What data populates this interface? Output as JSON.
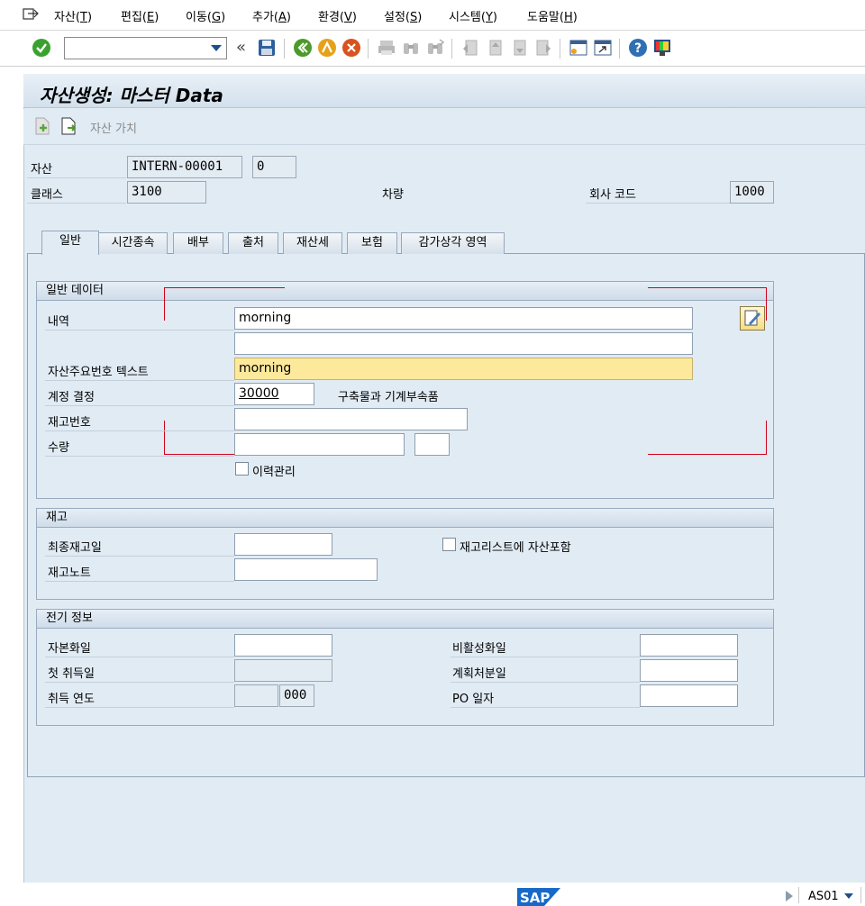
{
  "menu": {
    "items": [
      {
        "label": "자산(",
        "key": "T",
        "end": ")"
      },
      {
        "label": "편집(",
        "key": "E",
        "end": ")"
      },
      {
        "label": "이동(",
        "key": "G",
        "end": ")"
      },
      {
        "label": "추가(",
        "key": "A",
        "end": ")"
      },
      {
        "label": "환경(",
        "key": "V",
        "end": ")"
      },
      {
        "label": "설정(",
        "key": "S",
        "end": ")"
      },
      {
        "label": "시스템(",
        "key": "Y",
        "end": ")"
      },
      {
        "label": "도움말(",
        "key": "H",
        "end": ")"
      }
    ]
  },
  "toolbar": {
    "command_value": "",
    "icons": [
      "check-icon",
      "save-icon",
      "back-icon",
      "exit-icon",
      "cancel-icon",
      "print-icon",
      "find-icon",
      "find-next-icon",
      "first-page-icon",
      "prev-page-icon",
      "next-page-icon",
      "last-page-icon",
      "new-session-icon",
      "shortcut-icon",
      "help-icon",
      "customize-layout-icon"
    ],
    "collapse_glyph": "«"
  },
  "header": {
    "title": "자산생성:  마스터 Data"
  },
  "app_toolbar": {
    "asset_value_label": "자산 가치"
  },
  "asset_header": {
    "asset_label": "자산",
    "asset_number": "INTERN-00001",
    "sub_number": "0",
    "class_label": "클래스",
    "class_value": "3100",
    "vehicle_label": "차량",
    "company_code_label": "회사 코드",
    "company_code_value": "1000"
  },
  "tabs": [
    {
      "label": "일반",
      "active": true
    },
    {
      "label": "시간종속",
      "active": false
    },
    {
      "label": "배부",
      "active": false
    },
    {
      "label": "출처",
      "active": false
    },
    {
      "label": "재산세",
      "active": false
    },
    {
      "label": "보험",
      "active": false
    },
    {
      "label": "감가상각 영역",
      "active": false
    }
  ],
  "general_data": {
    "title": "일반 데이터",
    "description_label": "내역",
    "description_value": "morning",
    "description2_value": "",
    "main_number_text_label": "자산주요번호 텍스트",
    "main_number_text_value": "morning",
    "account_determination_label": "계정 결정",
    "account_determination_value": "30000",
    "account_determination_text": "구축물과 기계부속품",
    "inventory_number_label": "재고번호",
    "inventory_number_value": "",
    "quantity_label": "수량",
    "quantity_value": "",
    "unit_value": "",
    "history_label": "이력관리",
    "history_checked": false
  },
  "inventory": {
    "title": "재고",
    "last_inventory_date_label": "최종재고일",
    "last_inventory_date_value": "",
    "include_in_list_label": "재고리스트에 자산포함",
    "include_in_list_checked": false,
    "inventory_note_label": "재고노트",
    "inventory_note_value": ""
  },
  "posting_info": {
    "title": "전기 정보",
    "capitalized_on_label": "자본화일",
    "capitalized_on_value": "",
    "deactivation_on_label": "비활성화일",
    "deactivation_on_value": "",
    "first_acquisition_label": "첫 취득일",
    "first_acquisition_value": "",
    "planned_retirement_label": "계획처분일",
    "planned_retirement_value": "",
    "acquisition_year_label": "취득 연도",
    "acquisition_year_value": "",
    "acquisition_period_value": "000",
    "po_date_label": "PO 일자",
    "po_date_value": ""
  },
  "status": {
    "transaction": "AS01",
    "logo_text": "SAP"
  },
  "colors": {
    "accent": "#1f4e8c",
    "background": "#e1ebf4",
    "required_field": "#fde99b"
  }
}
